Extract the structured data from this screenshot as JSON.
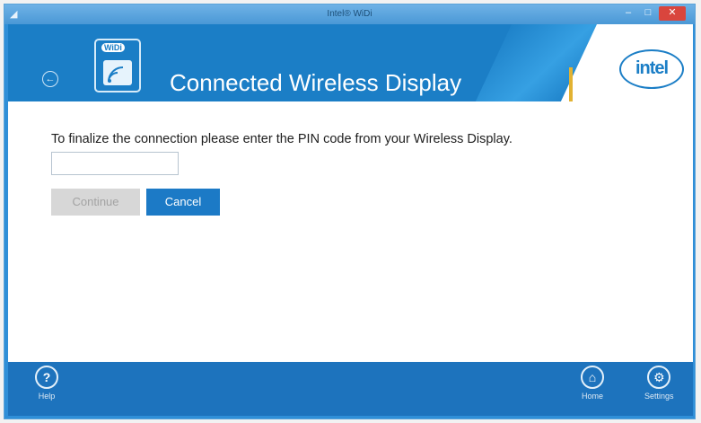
{
  "window": {
    "title": "Intel® WiDi"
  },
  "header": {
    "logo_tag": "WiDi",
    "title": "Connected Wireless Display",
    "brand": "intel"
  },
  "main": {
    "instruction": "To finalize the connection please enter the PIN code from your Wireless Display.",
    "pin_value": "",
    "continue_label": "Continue",
    "cancel_label": "Cancel"
  },
  "footer": {
    "help_label": "Help",
    "home_label": "Home",
    "settings_label": "Settings"
  },
  "icons": {
    "back": "back-arrow-icon",
    "help": "question-icon",
    "home": "home-icon",
    "settings": "gear-icon"
  },
  "colors": {
    "header_blue": "#1b7ec6",
    "footer_blue": "#1d73bd",
    "accent_gold": "#e2b232",
    "cancel_button": "#1c7ac6",
    "disabled_button": "#d7d7d7"
  }
}
